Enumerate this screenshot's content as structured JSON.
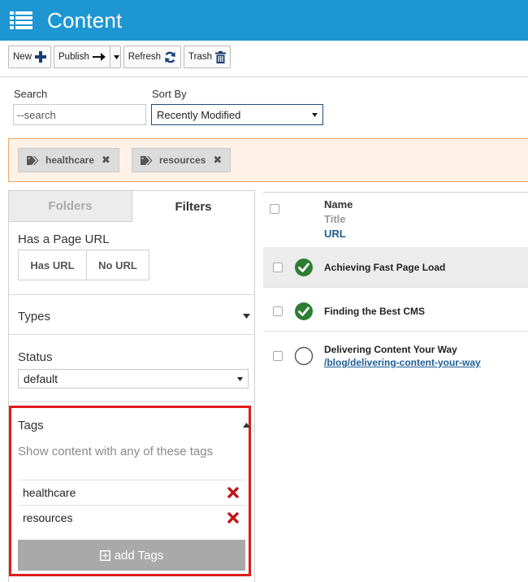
{
  "header": {
    "title": "Content"
  },
  "toolbar": {
    "new_label": "New",
    "publish_label": "Publish",
    "refresh_label": "Refresh",
    "trash_label": "Trash"
  },
  "search": {
    "label": "Search",
    "placeholder": "--search",
    "value": ""
  },
  "sort": {
    "label": "Sort By",
    "selected": "Recently Modified"
  },
  "active_tags": [
    "healthcare",
    "resources"
  ],
  "left_panel": {
    "tabs": [
      {
        "label": "Folders",
        "active": false
      },
      {
        "label": "Filters",
        "active": true
      }
    ],
    "page_url": {
      "title": "Has a Page URL",
      "options": [
        "Has URL",
        "No URL"
      ]
    },
    "types": {
      "title": "Types"
    },
    "status": {
      "title": "Status",
      "selected": "default"
    },
    "tags": {
      "title": "Tags",
      "hint": "Show content with any of these tags",
      "items": [
        "healthcare",
        "resources"
      ],
      "add_label": "add Tags"
    }
  },
  "list": {
    "columns": {
      "name": "Name",
      "title": "Title",
      "url": "URL"
    },
    "rows": [
      {
        "name": "Achieving Fast Page Load",
        "url": "",
        "published": true
      },
      {
        "name": "Finding the Best CMS",
        "url": "",
        "published": true
      },
      {
        "name": "Delivering Content Your Way",
        "url": "/blog/delivering-content-your-way",
        "published": false
      }
    ]
  },
  "colors": {
    "header_bg": "#1e96d2",
    "published_green": "#2e7d32",
    "remove_red": "#c0161b",
    "highlight_red": "#e01c1c",
    "url_blue": "#1e5d96"
  }
}
